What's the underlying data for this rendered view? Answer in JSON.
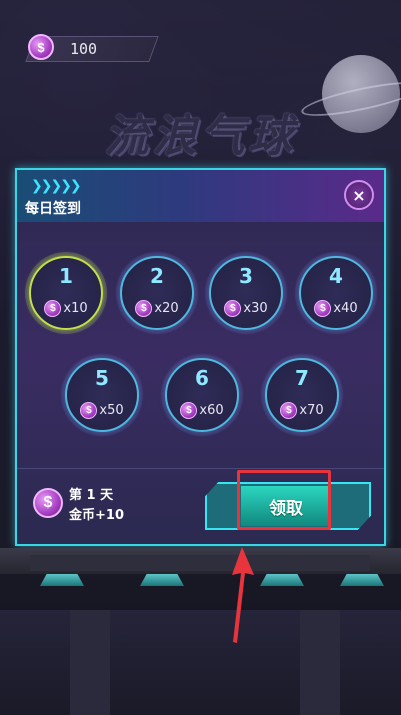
{
  "hud": {
    "coin_icon": "dollar-coin-icon",
    "coin_symbol": "$",
    "coins": "100"
  },
  "game_title": "流浪气球",
  "daily_checkin": {
    "title": "每日签到",
    "close_symbol": "×",
    "days": [
      {
        "day": "1",
        "reward": "x10"
      },
      {
        "day": "2",
        "reward": "x20"
      },
      {
        "day": "3",
        "reward": "x30"
      },
      {
        "day": "4",
        "reward": "x40"
      },
      {
        "day": "5",
        "reward": "x50"
      },
      {
        "day": "6",
        "reward": "x60"
      },
      {
        "day": "7",
        "reward": "x70"
      }
    ],
    "footer": {
      "day_text": "第 1 天",
      "reward_text": "金币+10"
    },
    "claim_label": "领取"
  },
  "colors": {
    "accent_cyan": "#36e6f2",
    "coin_purple": "#a63fc3",
    "highlight_red": "#e8343c"
  }
}
